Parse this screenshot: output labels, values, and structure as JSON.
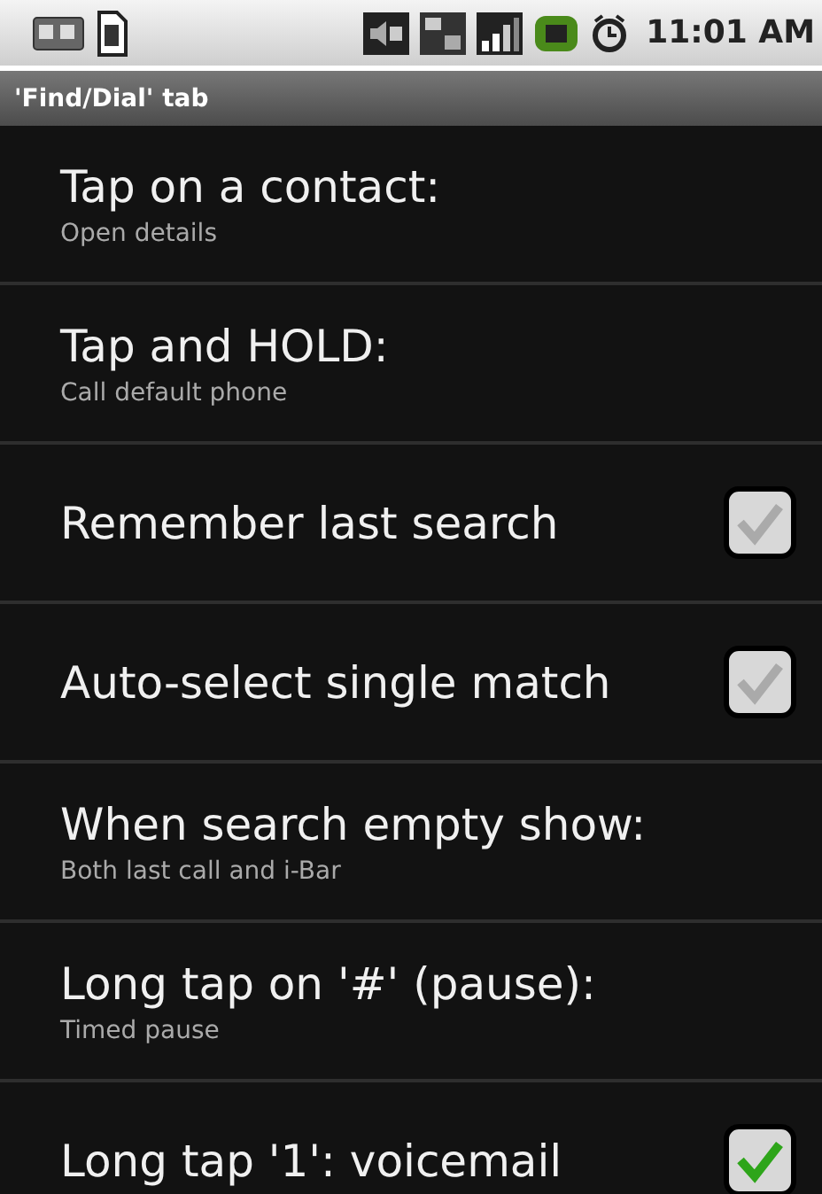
{
  "status_bar": {
    "time": "11:01 AM"
  },
  "title_bar": {
    "title": "'Find/Dial' tab"
  },
  "settings": [
    {
      "kind": "text",
      "title": "Tap on a contact:",
      "summary": "Open details"
    },
    {
      "kind": "text",
      "title": "Tap and HOLD:",
      "summary": "Call default phone"
    },
    {
      "kind": "checkbox",
      "title": "Remember last search",
      "checked": false
    },
    {
      "kind": "checkbox",
      "title": "Auto-select single match",
      "checked": false
    },
    {
      "kind": "text",
      "title": "When search empty show:",
      "summary": "Both last call and i-Bar"
    },
    {
      "kind": "text",
      "title": "Long tap on '#' (pause):",
      "summary": "Timed pause"
    },
    {
      "kind": "checkbox",
      "title": "Long tap '1': voicemail",
      "checked": true
    }
  ]
}
